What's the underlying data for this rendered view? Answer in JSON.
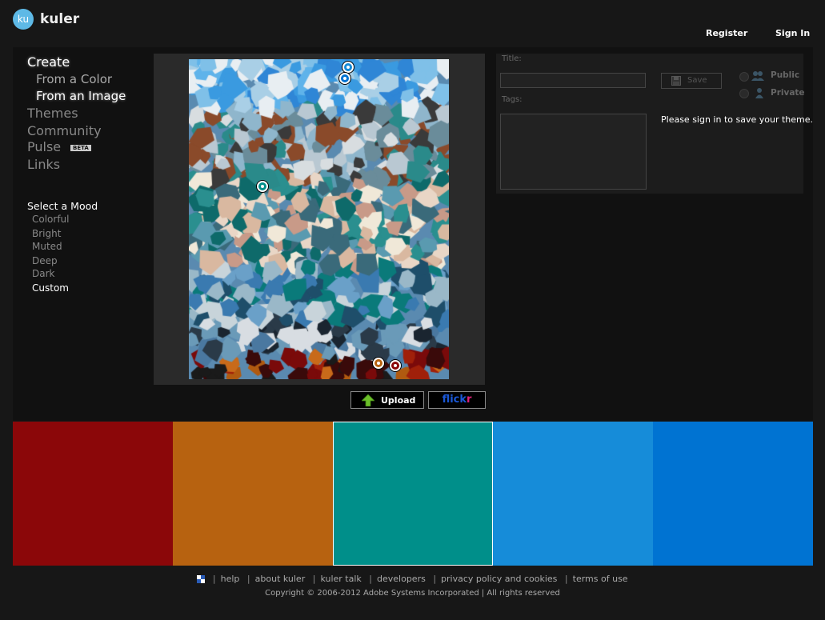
{
  "header": {
    "logo_badge": "ku",
    "logo_text": "kuler",
    "register": "Register",
    "sign_in": "Sign In"
  },
  "nav": {
    "create": "Create",
    "from_color": "From a Color",
    "from_image": "From an Image",
    "themes": "Themes",
    "community": "Community",
    "pulse": "Pulse",
    "beta": "BETA",
    "links": "Links"
  },
  "mood": {
    "title": "Select a Mood",
    "items": [
      "Colorful",
      "Bright",
      "Muted",
      "Deep",
      "Dark",
      "Custom"
    ],
    "selected": "Custom"
  },
  "image_buttons": {
    "upload": "Upload",
    "flickr_a": "flick",
    "flickr_b": "r"
  },
  "form": {
    "title_label": "Title:",
    "tags_label": "Tags:",
    "save": "Save",
    "public": "Public",
    "private": "Private",
    "signin_message": "Please sign in to save your theme."
  },
  "swatches": [
    "#8b0709",
    "#b76210",
    "#008f8a",
    "#168cd9",
    "#0073d2"
  ],
  "selected_swatch": 2,
  "markers": [
    {
      "color": "#168cd9"
    },
    {
      "color": "#0073d2"
    },
    {
      "color": "#008f8a"
    },
    {
      "color": "#b76210"
    },
    {
      "color": "#8b0709"
    }
  ],
  "footer": {
    "links": [
      "help",
      "about kuler",
      "kuler talk",
      "developers",
      "privacy policy and cookies",
      "terms of use"
    ],
    "copyright": "Copyright © 2006-2012 Adobe Systems Incorporated | All rights reserved"
  }
}
